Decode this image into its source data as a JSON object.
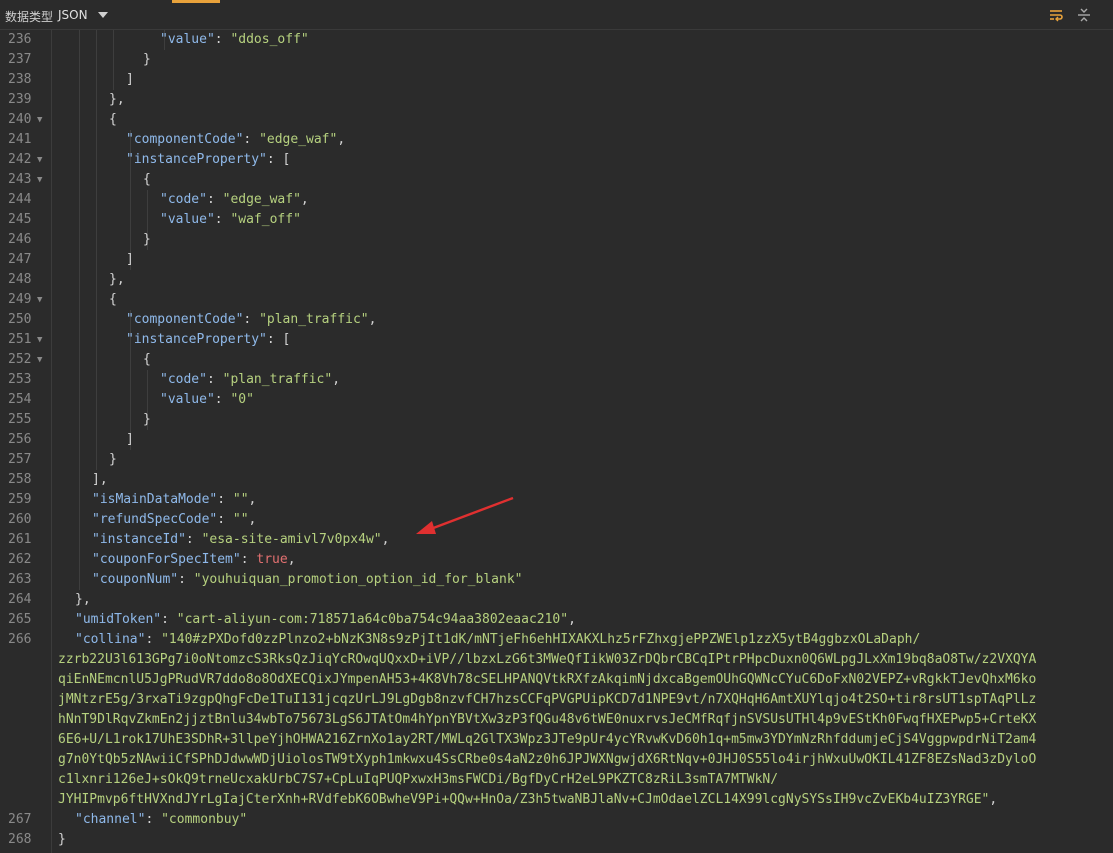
{
  "toolbar": {
    "data_type_label": "数据类型",
    "data_type_value": "JSON"
  },
  "code": {
    "first_line": 236,
    "lines": [
      {
        "n": 236,
        "fold": false,
        "indent": 6,
        "t": [
          [
            "k",
            "\"value\""
          ],
          [
            "p",
            ": "
          ],
          [
            "s",
            "\"ddos_off\""
          ]
        ]
      },
      {
        "n": 237,
        "fold": false,
        "indent": 5,
        "t": [
          [
            "p",
            "}"
          ]
        ]
      },
      {
        "n": 238,
        "fold": false,
        "indent": 4,
        "t": [
          [
            "p",
            "]"
          ]
        ]
      },
      {
        "n": 239,
        "fold": false,
        "indent": 3,
        "t": [
          [
            "p",
            "},"
          ]
        ]
      },
      {
        "n": 240,
        "fold": true,
        "indent": 3,
        "t": [
          [
            "p",
            "{"
          ]
        ]
      },
      {
        "n": 241,
        "fold": false,
        "indent": 4,
        "t": [
          [
            "k",
            "\"componentCode\""
          ],
          [
            "p",
            ": "
          ],
          [
            "s",
            "\"edge_waf\""
          ],
          [
            "p",
            ","
          ]
        ]
      },
      {
        "n": 242,
        "fold": true,
        "indent": 4,
        "t": [
          [
            "k",
            "\"instanceProperty\""
          ],
          [
            "p",
            ": ["
          ]
        ]
      },
      {
        "n": 243,
        "fold": true,
        "indent": 5,
        "t": [
          [
            "p",
            "{"
          ]
        ]
      },
      {
        "n": 244,
        "fold": false,
        "indent": 6,
        "t": [
          [
            "k",
            "\"code\""
          ],
          [
            "p",
            ": "
          ],
          [
            "s",
            "\"edge_waf\""
          ],
          [
            "p",
            ","
          ]
        ]
      },
      {
        "n": 245,
        "fold": false,
        "indent": 6,
        "t": [
          [
            "k",
            "\"value\""
          ],
          [
            "p",
            ": "
          ],
          [
            "s",
            "\"waf_off\""
          ]
        ]
      },
      {
        "n": 246,
        "fold": false,
        "indent": 5,
        "t": [
          [
            "p",
            "}"
          ]
        ]
      },
      {
        "n": 247,
        "fold": false,
        "indent": 4,
        "t": [
          [
            "p",
            "]"
          ]
        ]
      },
      {
        "n": 248,
        "fold": false,
        "indent": 3,
        "t": [
          [
            "p",
            "},"
          ]
        ]
      },
      {
        "n": 249,
        "fold": true,
        "indent": 3,
        "t": [
          [
            "p",
            "{"
          ]
        ]
      },
      {
        "n": 250,
        "fold": false,
        "indent": 4,
        "t": [
          [
            "k",
            "\"componentCode\""
          ],
          [
            "p",
            ": "
          ],
          [
            "s",
            "\"plan_traffic\""
          ],
          [
            "p",
            ","
          ]
        ]
      },
      {
        "n": 251,
        "fold": true,
        "indent": 4,
        "t": [
          [
            "k",
            "\"instanceProperty\""
          ],
          [
            "p",
            ": ["
          ]
        ]
      },
      {
        "n": 252,
        "fold": true,
        "indent": 5,
        "t": [
          [
            "p",
            "{"
          ]
        ]
      },
      {
        "n": 253,
        "fold": false,
        "indent": 6,
        "t": [
          [
            "k",
            "\"code\""
          ],
          [
            "p",
            ": "
          ],
          [
            "s",
            "\"plan_traffic\""
          ],
          [
            "p",
            ","
          ]
        ]
      },
      {
        "n": 254,
        "fold": false,
        "indent": 6,
        "t": [
          [
            "k",
            "\"value\""
          ],
          [
            "p",
            ": "
          ],
          [
            "s",
            "\"0\""
          ]
        ]
      },
      {
        "n": 255,
        "fold": false,
        "indent": 5,
        "t": [
          [
            "p",
            "}"
          ]
        ]
      },
      {
        "n": 256,
        "fold": false,
        "indent": 4,
        "t": [
          [
            "p",
            "]"
          ]
        ]
      },
      {
        "n": 257,
        "fold": false,
        "indent": 3,
        "t": [
          [
            "p",
            "}"
          ]
        ]
      },
      {
        "n": 258,
        "fold": false,
        "indent": 2,
        "t": [
          [
            "p",
            "],"
          ]
        ]
      },
      {
        "n": 259,
        "fold": false,
        "indent": 2,
        "t": [
          [
            "k",
            "\"isMainDataMode\""
          ],
          [
            "p",
            ": "
          ],
          [
            "s",
            "\"\""
          ],
          [
            "p",
            ","
          ]
        ]
      },
      {
        "n": 260,
        "fold": false,
        "indent": 2,
        "t": [
          [
            "k",
            "\"refundSpecCode\""
          ],
          [
            "p",
            ": "
          ],
          [
            "s",
            "\"\""
          ],
          [
            "p",
            ","
          ]
        ]
      },
      {
        "n": 261,
        "fold": false,
        "indent": 2,
        "t": [
          [
            "k",
            "\"instanceId\""
          ],
          [
            "p",
            ": "
          ],
          [
            "s",
            "\"esa-site-amivl7v0px4w\""
          ],
          [
            "p",
            ","
          ]
        ]
      },
      {
        "n": 262,
        "fold": false,
        "indent": 2,
        "t": [
          [
            "k",
            "\"couponForSpecItem\""
          ],
          [
            "p",
            ": "
          ],
          [
            "b",
            "true"
          ],
          [
            "p",
            ","
          ]
        ]
      },
      {
        "n": 263,
        "fold": false,
        "indent": 2,
        "t": [
          [
            "k",
            "\"couponNum\""
          ],
          [
            "p",
            ": "
          ],
          [
            "s",
            "\"youhuiquan_promotion_option_id_for_blank\""
          ]
        ]
      },
      {
        "n": 264,
        "fold": false,
        "indent": 1,
        "t": [
          [
            "p",
            "},"
          ]
        ]
      },
      {
        "n": 265,
        "fold": false,
        "indent": 1,
        "t": [
          [
            "k",
            "\"umidToken\""
          ],
          [
            "p",
            ": "
          ],
          [
            "s",
            "\"cart-aliyun-com:718571a64c0ba754c94aa3802eaac210\""
          ],
          [
            "p",
            ","
          ]
        ]
      },
      {
        "n": 266,
        "fold": false,
        "indent": 1,
        "t": [
          [
            "k",
            "\"collina\""
          ],
          [
            "p",
            ": "
          ],
          [
            "s",
            "\"140#zPXDofd0zzPlnzo2+bNzK3N8s9zPjIt1dK/mNTjeFh6ehHIXAKXLhz5rFZhxgjePPZWElp1zzX5ytB4ggbzxOLaDaph/"
          ]
        ]
      },
      {
        "n": null,
        "fold": false,
        "indent": 0,
        "t": [
          [
            "s",
            "zzrb22U3l613GPg7i0oNtomzcS3RksQzJiqYcROwqUQxxD+iVP//lbzxLzG6t3MWeQfIikW03ZrDQbrCBCqIPtrPHpcDuxn0Q6WLpgJLxXm19bq8aO8Tw/z2VXQYA"
          ]
        ]
      },
      {
        "n": null,
        "fold": false,
        "indent": 0,
        "t": [
          [
            "s",
            "qiEnNEmcnlU5JgPRudVR7ddo8o8OdXECQixJYmpenAH53+4K8Vh78cSELHPANQVtkRXfzAkqimNjdxcaBgemOUhGQWNcCYuC6DoFxN02VEPZ+vRgkkTJevQhxM6ko"
          ]
        ]
      },
      {
        "n": null,
        "fold": false,
        "indent": 0,
        "t": [
          [
            "s",
            "jMNtzrE5g/3rxaTi9zgpQhgFcDe1TuI131jcqzUrLJ9LgDgb8nzvfCH7hzsCCFqPVGPUipKCD7d1NPE9vt/n7XQHqH6AmtXUYlqjo4t2SO+tir8rsUT1spTAqPlLz"
          ]
        ]
      },
      {
        "n": null,
        "fold": false,
        "indent": 0,
        "t": [
          [
            "s",
            "hNnT9DlRqvZkmEn2jjztBnlu34wbTo75673LgS6JTAtOm4hYpnYBVtXw3zP3fQGu48v6tWE0nuxrvsJeCMfRqfjnSVSUsUTHl4p9vEStKh0FwqfHXEPwp5+CrteKX"
          ]
        ]
      },
      {
        "n": null,
        "fold": false,
        "indent": 0,
        "t": [
          [
            "s",
            "6E6+U/L1rok17UhE3SDhR+3llpeYjhOHWA216ZrnXo1ay2RT/MWLq2GlTX3Wpz3JTe9pUr4ycYRvwKvD60h1q+m5mw3YDYmNzRhfddumjeCjS4VggpwpdrNiT2am4"
          ]
        ]
      },
      {
        "n": null,
        "fold": false,
        "indent": 0,
        "t": [
          [
            "s",
            "g7n0YtQb5zNAwiiCfSPhDJdwwWDjUiolosTW9tXyph1mkwxu4SsCRbe0s4aN2z0h6JPJWXNgwjdX6RtNqv+0JHJ0S55lo4irjhWxuUwOKIL41ZF8EZsNad3zDyloO"
          ]
        ]
      },
      {
        "n": null,
        "fold": false,
        "indent": 0,
        "t": [
          [
            "s",
            "c1lxnri126eJ+sOkQ9trneUcxakUrbC7S7+CpLuIqPUQPxwxH3msFWCDi/BgfDyCrH2eL9PKZTC8zRiL3smTA7MTWkN/"
          ]
        ]
      },
      {
        "n": null,
        "fold": false,
        "indent": 0,
        "t": [
          [
            "s",
            "JYHIPmvp6ftHVXndJYrLgIajCterXnh+RVdfebK6OBwheV9Pi+QQw+HnOa/Z3h5twaNBJlaNv+CJmOdaelZCL14X99lcgNySYSsIH9vcZvEKb4uIZ3YRGE\""
          ],
          [
            "p",
            ","
          ]
        ]
      },
      {
        "n": 267,
        "fold": false,
        "indent": 1,
        "t": [
          [
            "k",
            "\"channel\""
          ],
          [
            "p",
            ": "
          ],
          [
            "s",
            "\"commonbuy\""
          ]
        ]
      },
      {
        "n": 268,
        "fold": false,
        "indent": 0,
        "t": [
          [
            "p",
            "}"
          ]
        ]
      }
    ]
  }
}
